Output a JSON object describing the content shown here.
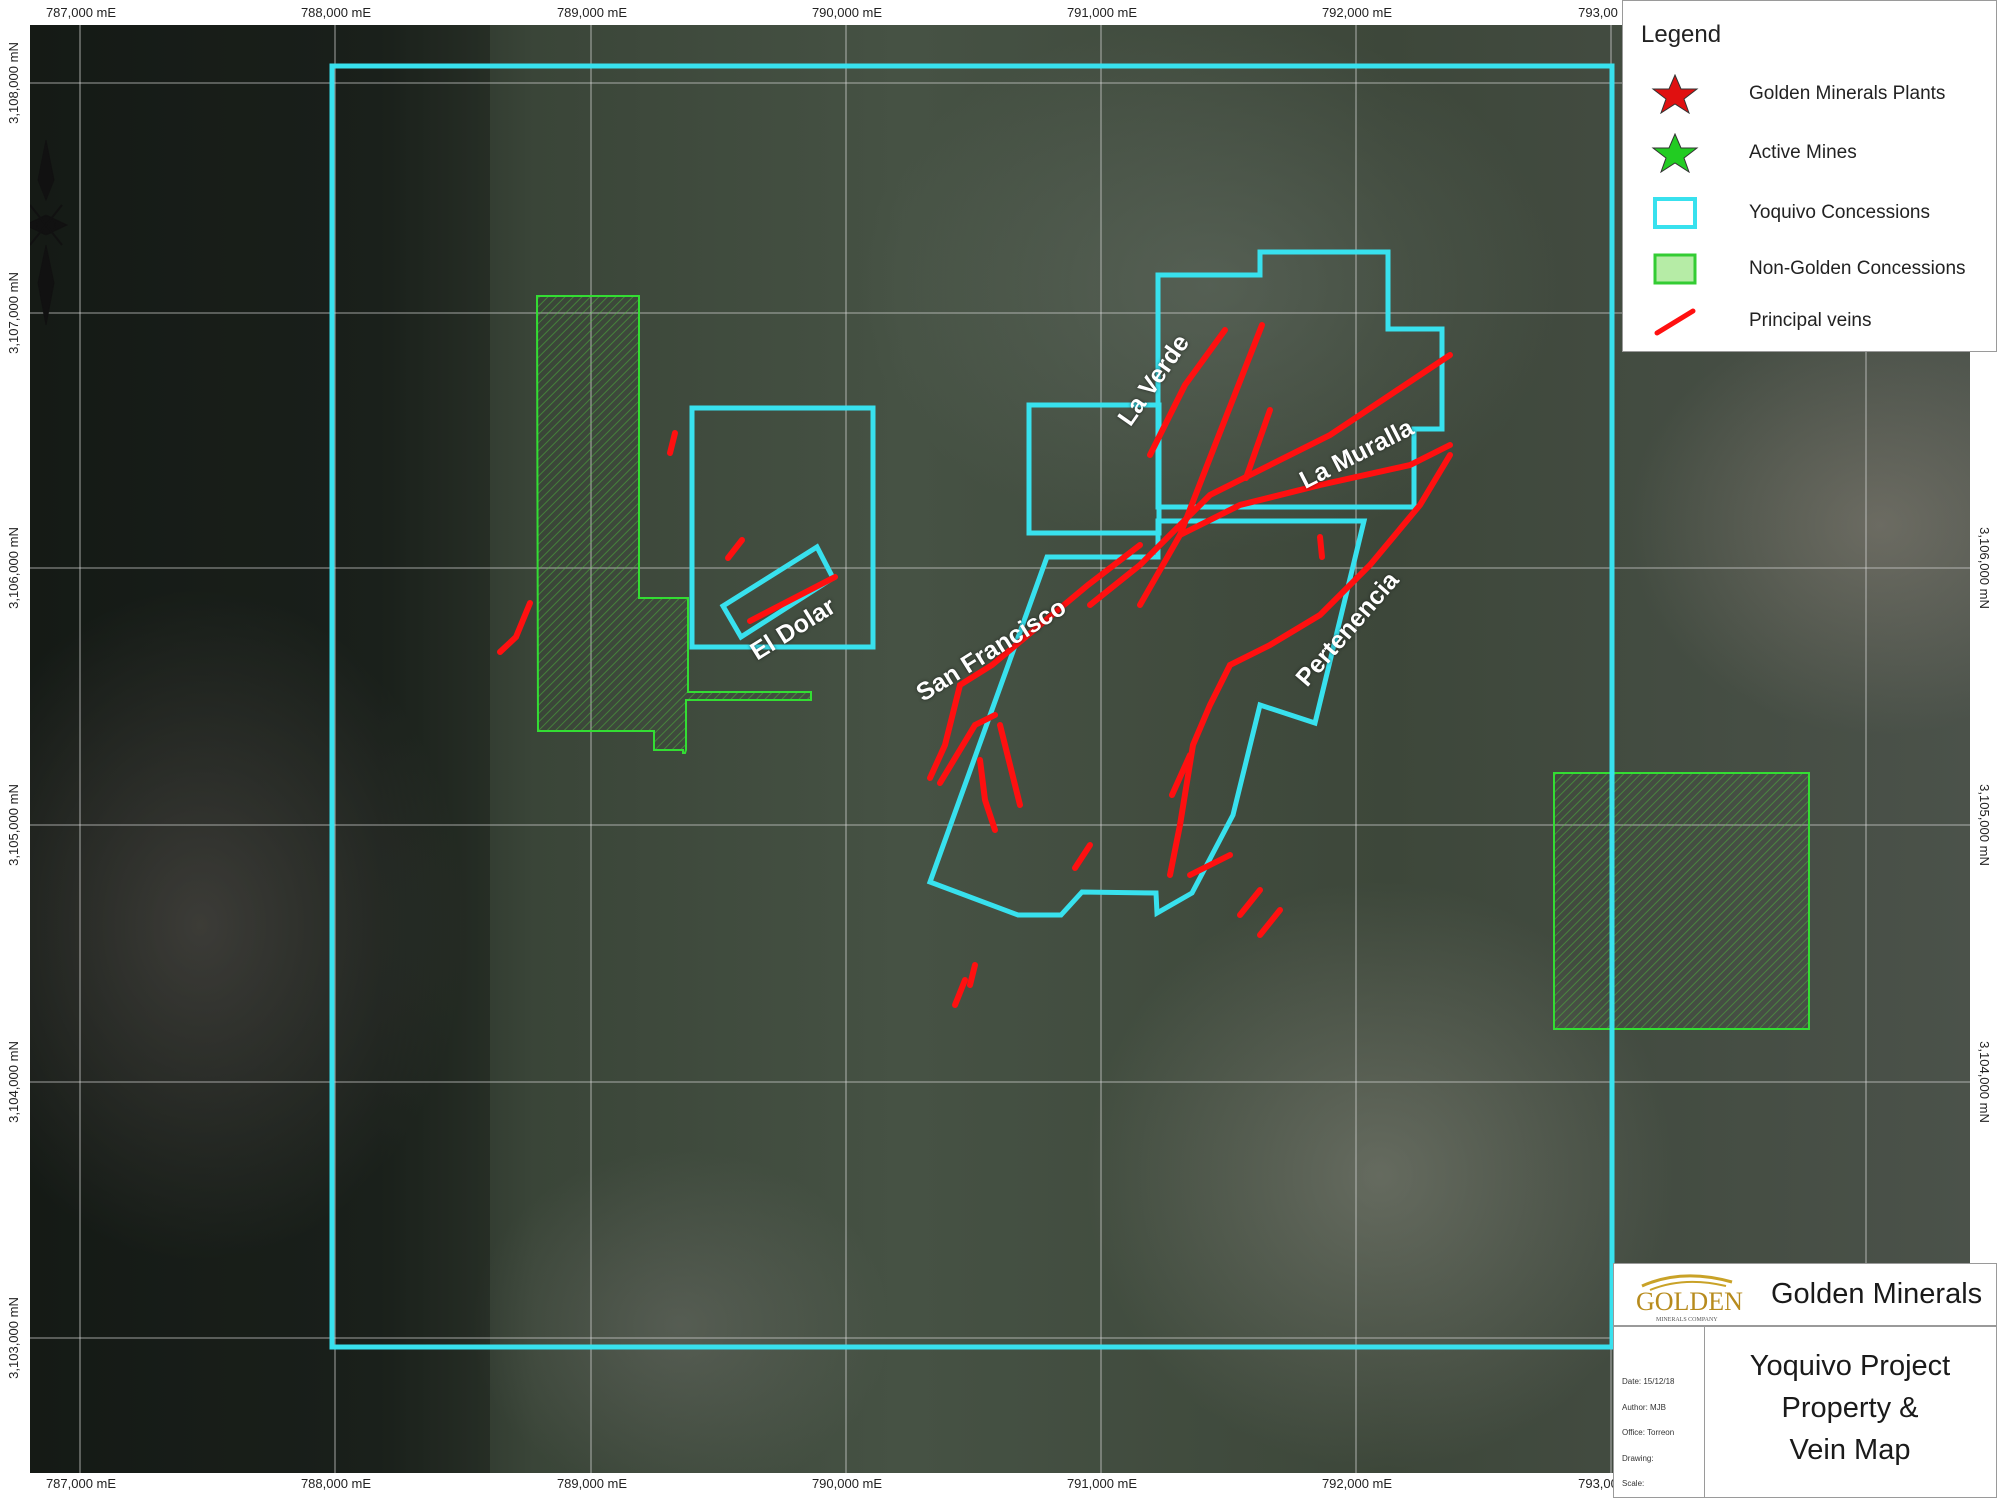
{
  "top_coords": [
    "787,000 mE",
    "788,000 mE",
    "789,000 mE",
    "790,000 mE",
    "791,000 mE",
    "792,000 mE",
    "793,00"
  ],
  "bottom_coords": [
    "787,000 mE",
    "788,000 mE",
    "789,000 mE",
    "790,000 mE",
    "791,000 mE",
    "792,000 mE",
    "793,00"
  ],
  "left_coords": [
    "3,108,000 mN",
    "3,107,000 mN",
    "3,106,000 mN",
    "3,105,000 mN",
    "3,104,000 mN",
    "3,103,000 mN"
  ],
  "right_coords": [
    "3,106,000 mN",
    "3,105,000 mN",
    "3,104,000 mN"
  ],
  "map_labels": {
    "la_verde": "La Verde",
    "la_muralla": "La Muralla",
    "el_dolar": "El Dolar",
    "san_francisco": "San Francisco",
    "pertenencia": "Pertenencia"
  },
  "legend": {
    "title": "Legend",
    "items": [
      {
        "label": "Golden Minerals Plants",
        "symbol": "red-star",
        "color": "#e01010"
      },
      {
        "label": "Active Mines",
        "symbol": "green-star",
        "color": "#22cc22"
      },
      {
        "label": "Yoquivo Concessions",
        "symbol": "cyan-outline-box",
        "color": "#38e1ee"
      },
      {
        "label": "Non-Golden Concessions",
        "symbol": "green-fill-box",
        "color": "#33cc33"
      },
      {
        "label": "Principal veins",
        "symbol": "red-line",
        "color": "#ff1010"
      }
    ]
  },
  "logo": {
    "mark_text": "GOLDEN",
    "mark_subtext": "MINERALS COMPANY",
    "company_name": "Golden Minerals"
  },
  "title_block": {
    "date": "Date: 15/12/18",
    "author": "Author: MJB",
    "office": "Office: Torreon",
    "drawing": "Drawing:",
    "scale": "Scale:",
    "title_line1": "Yoquivo Project",
    "title_line2": "Property &",
    "title_line3": "Vein Map"
  },
  "colors": {
    "concession": "#38e1ee",
    "vein": "#ff1010",
    "non_golden": "#33cc33"
  }
}
